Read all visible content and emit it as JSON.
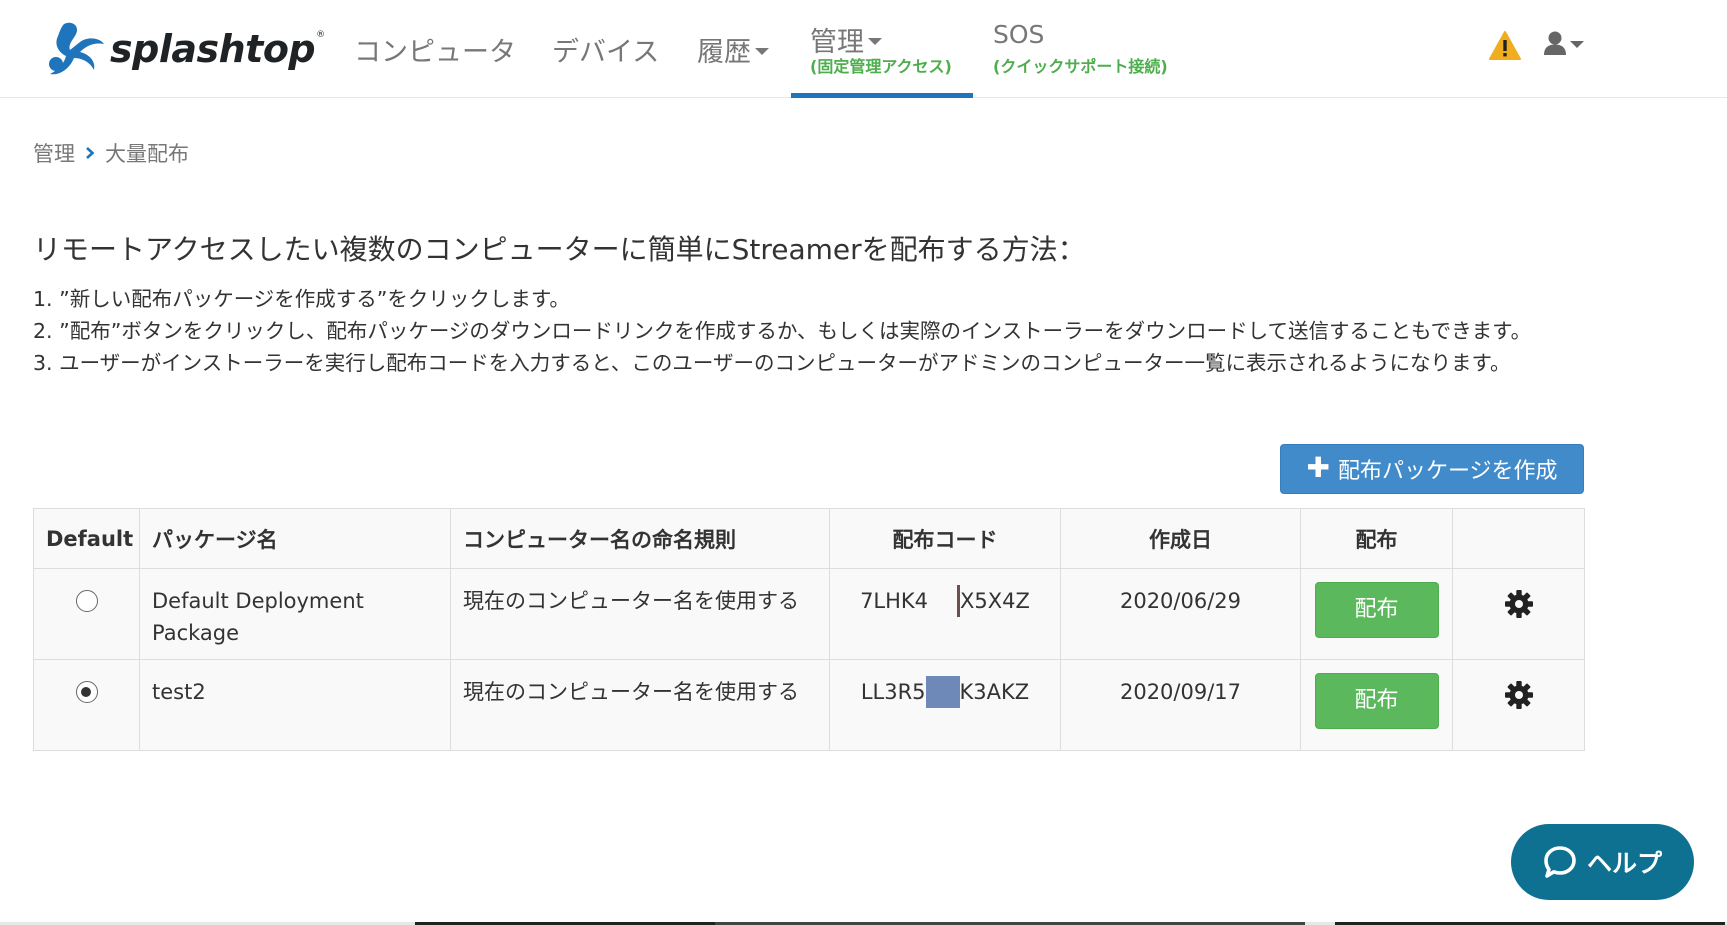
{
  "brand": {
    "name": "splashtop",
    "reg": "®"
  },
  "nav": {
    "computers": "コンピュータ",
    "devices": "デバイス",
    "history": "履歴",
    "manage": "管理",
    "manage_sub": "(固定管理アクセス)",
    "sos": "SOS",
    "sos_sub": "(クイックサポート接続)"
  },
  "icons": {
    "warning": "warning-icon",
    "user": "user-icon",
    "gear": "gear-icon",
    "chat": "chat-bubble-icon",
    "chevron": "chevron-right-icon",
    "caret": "caret-down-icon"
  },
  "colors": {
    "primary": "#428bca",
    "success": "#5cb85c",
    "active_nav": "#1e75bb",
    "sub_green": "#4cae4c",
    "help": "#0e7192",
    "warning": "#f0ad1e"
  },
  "breadcrumb": {
    "parent": "管理",
    "current": "大量配布"
  },
  "instructions": {
    "heading": "リモートアクセスしたい複数のコンピューターに簡単にStreamerを配布する方法：",
    "step1": "1. ”新しい配布パッケージを作成する”をクリックします。",
    "step2": "2. ”配布”ボタンをクリックし、配布パッケージのダウンロードリンクを作成するか、もしくは実際のインストーラーをダウンロードして送信することもできます。",
    "step3": "3. ユーザーがインストーラーを実行し配布コードを入力すると、このユーザーのコンピューターがアドミンのコンピューター一覧に表示されるようになります。"
  },
  "create_button": "配布パッケージを作成",
  "table": {
    "headers": {
      "default": "Default",
      "package": "パッケージ名",
      "naming": "コンピューター名の命名規則",
      "code": "配布コード",
      "date": "作成日",
      "deploy": "配布"
    },
    "rows": [
      {
        "selected": false,
        "package": "Default Deployment Package",
        "naming": "現在のコンピューター名を使用する",
        "code_start": "7LHK4",
        "code_end": "X5X4Z",
        "date": "2020/06/29",
        "deploy": "配布"
      },
      {
        "selected": true,
        "package": "test2",
        "naming": "現在のコンピューター名を使用する",
        "code_start": "LL3R5",
        "code_end": "K3AKZ",
        "date": "2020/09/17",
        "deploy": "配布"
      }
    ]
  },
  "help_button": "ヘルプ"
}
